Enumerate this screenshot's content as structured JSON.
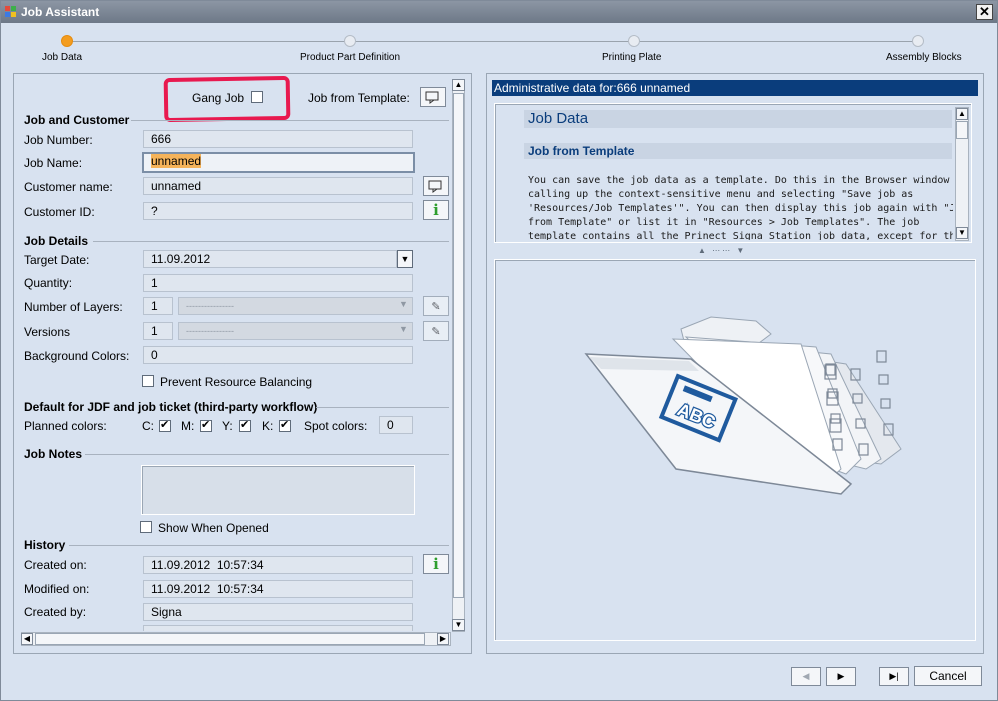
{
  "window": {
    "title": "Job Assistant",
    "close_glyph": "✕"
  },
  "steps": [
    {
      "label": "Job Data",
      "active": true
    },
    {
      "label": "Product Part Definition",
      "active": false
    },
    {
      "label": "Printing Plate",
      "active": false
    },
    {
      "label": "Assembly Blocks",
      "active": false
    }
  ],
  "top": {
    "gang_job_label": "Gang Job",
    "job_from_template_label": "Job from Template:"
  },
  "job_customer": {
    "title": "Job and Customer",
    "job_number_label": "Job Number:",
    "job_number": "666",
    "job_name_label": "Job Name:",
    "job_name": "unnamed",
    "customer_name_label": "Customer name:",
    "customer_name": "unnamed",
    "customer_id_label": "Customer ID:",
    "customer_id": "?"
  },
  "job_details": {
    "title": "Job Details",
    "target_date_label": "Target Date:",
    "target_date": "11.09.2012",
    "quantity_label": "Quantity:",
    "quantity": "1",
    "layers_label": "Number of Layers:",
    "layers": "1",
    "layers_select": "----------------",
    "versions_label": "Versions",
    "versions": "1",
    "versions_select": "----------------",
    "bg_colors_label": "Background Colors:",
    "bg_colors": "0",
    "prevent_label": "Prevent Resource Balancing"
  },
  "jdf": {
    "title": "Default for JDF and job ticket (third-party workflow)",
    "planned_label": "Planned colors:",
    "c": "C:",
    "m": "M:",
    "y": "Y:",
    "k": "K:",
    "spot_label": "Spot colors:",
    "spot": "0"
  },
  "notes": {
    "title": "Job Notes",
    "show_when_opened": "Show When Opened"
  },
  "history": {
    "title": "History",
    "created_on_label": "Created on:",
    "created_on": "11.09.2012  10:57:34",
    "modified_on_label": "Modified on:",
    "modified_on": "11.09.2012  10:57:34",
    "created_by_label": "Created by:",
    "created_by": "Signa"
  },
  "help": {
    "header": "Administrative data for:666  unnamed",
    "heading": "Job Data",
    "subheading": "Job from Template",
    "lines": [
      "You can save the job data as a template. Do this in the Browser window by",
      "calling up the context-sensitive menu and selecting \"Save job as",
      "'Resources/Job Templates'\". You can then display this job again with \"Job",
      "from Template\" or list it in \"Resources > Job Templates\". The job",
      "template contains all the Prinect Signa Station job data, except for the"
    ]
  },
  "illustration": {
    "folder_label": "ABC"
  },
  "buttons": {
    "prev": "◀",
    "next": "▶",
    "last": "▶|",
    "cancel": "Cancel"
  },
  "colors": {
    "accent": "#f39c1e",
    "header_blue": "#0a3d7c",
    "highlight": "#e8194f"
  }
}
